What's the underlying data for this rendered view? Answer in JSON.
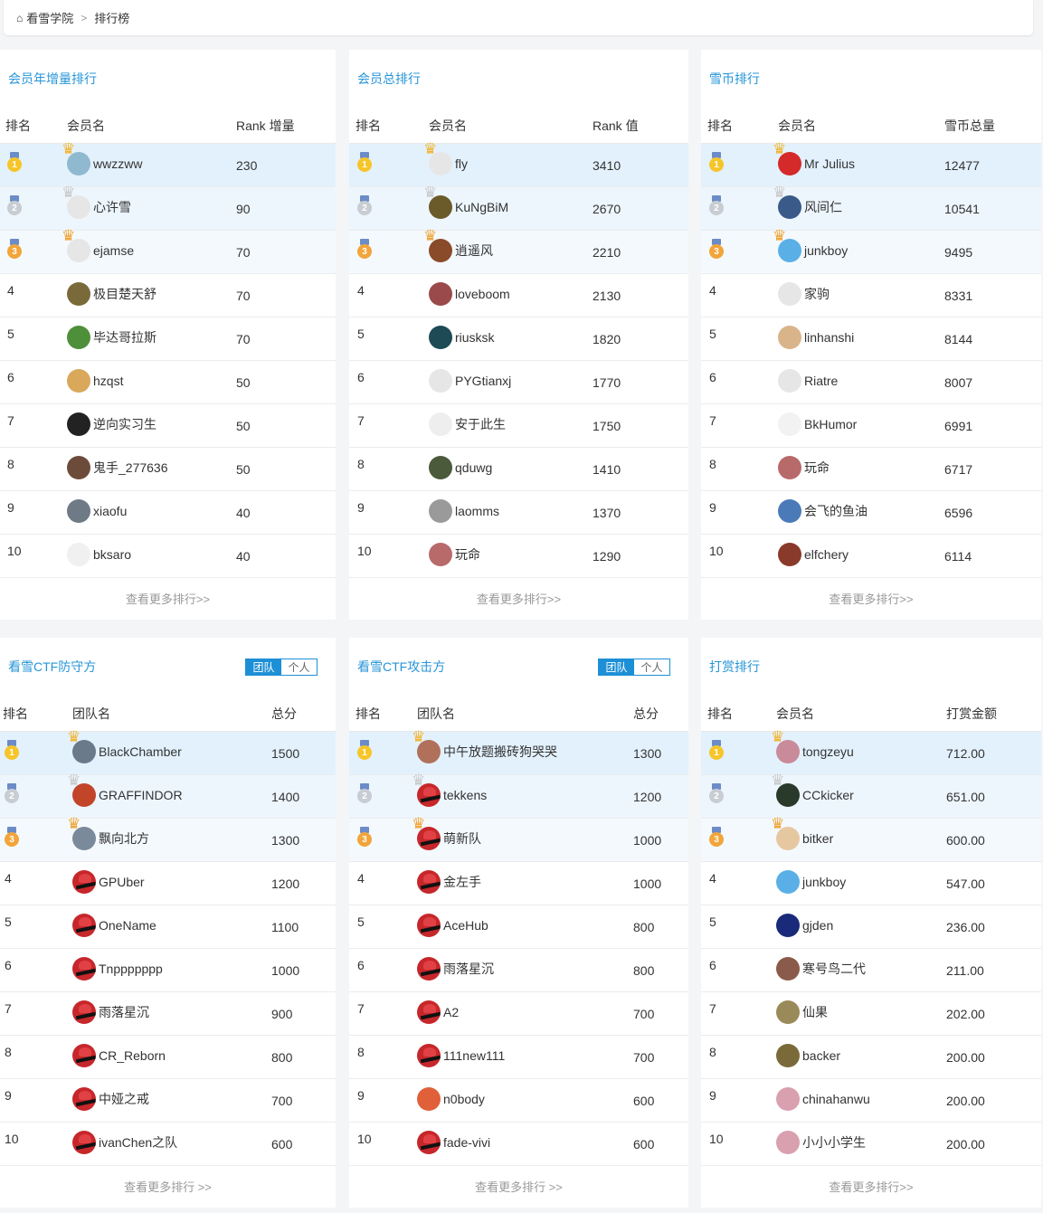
{
  "breadcrumb": {
    "home": "看雪学院",
    "current": "排行榜"
  },
  "more_label": "查看更多排行>>",
  "more_label_spaced": "查看更多排行 >>",
  "toggle": {
    "team": "团队",
    "personal": "个人"
  },
  "panels": [
    {
      "title": "会员年增量排行",
      "headers": [
        "排名",
        "会员名",
        "Rank 增量"
      ],
      "rows": [
        {
          "rank": "1",
          "name": "wwzzww",
          "value": "230",
          "avatar": "#8fb9cf"
        },
        {
          "rank": "2",
          "name": "心许雪",
          "value": "90",
          "avatar": "#e6e6e6"
        },
        {
          "rank": "3",
          "name": "ejamse",
          "value": "70",
          "avatar": "#e6e6e6"
        },
        {
          "rank": "4",
          "name": "极目楚天舒",
          "value": "70",
          "avatar": "#7a6a3a"
        },
        {
          "rank": "5",
          "name": "毕达哥拉斯",
          "value": "70",
          "avatar": "#4e8f3a"
        },
        {
          "rank": "6",
          "name": "hzqst",
          "value": "50",
          "avatar": "#d9a85a"
        },
        {
          "rank": "7",
          "name": "逆向实习生",
          "value": "50",
          "avatar": "#222222"
        },
        {
          "rank": "8",
          "name": "鬼手_277636",
          "value": "50",
          "avatar": "#6d4b3b"
        },
        {
          "rank": "9",
          "name": "xiaofu",
          "value": "40",
          "avatar": "#6e7a86"
        },
        {
          "rank": "10",
          "name": "bksaro",
          "value": "40",
          "avatar": "#f0f0f0"
        }
      ]
    },
    {
      "title": "会员总排行",
      "headers": [
        "排名",
        "会员名",
        "Rank 值"
      ],
      "rows": [
        {
          "rank": "1",
          "name": "fly",
          "value": "3410",
          "avatar": "#e6e6e6"
        },
        {
          "rank": "2",
          "name": "KuNgBiM",
          "value": "2670",
          "avatar": "#6b5a2a"
        },
        {
          "rank": "3",
          "name": "逍遥风",
          "value": "2210",
          "avatar": "#8a4b2a"
        },
        {
          "rank": "4",
          "name": "loveboom",
          "value": "2130",
          "avatar": "#9a4a4a"
        },
        {
          "rank": "5",
          "name": "riusksk",
          "value": "1820",
          "avatar": "#1d4a55"
        },
        {
          "rank": "6",
          "name": "PYGtianxj",
          "value": "1770",
          "avatar": "#e6e6e6"
        },
        {
          "rank": "7",
          "name": "安于此生",
          "value": "1750",
          "avatar": "#eeeeee"
        },
        {
          "rank": "8",
          "name": "qduwg",
          "value": "1410",
          "avatar": "#4a5a3a"
        },
        {
          "rank": "9",
          "name": "laomms",
          "value": "1370",
          "avatar": "#9a9a9a"
        },
        {
          "rank": "10",
          "name": "玩命",
          "value": "1290",
          "avatar": "#b86a6a"
        }
      ]
    },
    {
      "title": "雪币排行",
      "headers": [
        "排名",
        "会员名",
        "雪币总量"
      ],
      "rows": [
        {
          "rank": "1",
          "name": "Mr Julius",
          "value": "12477",
          "avatar": "#d42a2a"
        },
        {
          "rank": "2",
          "name": "风间仁",
          "value": "10541",
          "avatar": "#3a5a8a"
        },
        {
          "rank": "3",
          "name": "junkboy",
          "value": "9495",
          "avatar": "#5ab0e6"
        },
        {
          "rank": "4",
          "name": "家驹",
          "value": "8331",
          "avatar": "#e6e6e6"
        },
        {
          "rank": "5",
          "name": "linhanshi",
          "value": "8144",
          "avatar": "#d9b48a"
        },
        {
          "rank": "6",
          "name": "Riatre",
          "value": "8007",
          "avatar": "#e6e6e6"
        },
        {
          "rank": "7",
          "name": "BkHumor",
          "value": "6991",
          "avatar": "#f2f2f2"
        },
        {
          "rank": "8",
          "name": "玩命",
          "value": "6717",
          "avatar": "#b86a6a"
        },
        {
          "rank": "9",
          "name": "会飞的鱼油",
          "value": "6596",
          "avatar": "#4a7ab8"
        },
        {
          "rank": "10",
          "name": "elfchery",
          "value": "6114",
          "avatar": "#8a3a2a"
        }
      ]
    },
    {
      "title": "看雪CTF防守方",
      "toggle": true,
      "headers": [
        "排名",
        "团队名",
        "总分"
      ],
      "rows": [
        {
          "rank": "1",
          "name": "BlackChamber",
          "value": "1500",
          "avatar": "#6a7a8a"
        },
        {
          "rank": "2",
          "name": "GRAFFINDOR",
          "value": "1400",
          "avatar": "#c2452a"
        },
        {
          "rank": "3",
          "name": "飘向北方",
          "value": "1300",
          "avatar": "#7a8a9a"
        },
        {
          "rank": "4",
          "name": "GPUber",
          "value": "1200",
          "avatar": "hat"
        },
        {
          "rank": "5",
          "name": "OneName",
          "value": "1100",
          "avatar": "hat"
        },
        {
          "rank": "6",
          "name": "Tnppppppp",
          "value": "1000",
          "avatar": "hat"
        },
        {
          "rank": "7",
          "name": "雨落星沉",
          "value": "900",
          "avatar": "hat"
        },
        {
          "rank": "8",
          "name": "CR_Reborn",
          "value": "800",
          "avatar": "hat"
        },
        {
          "rank": "9",
          "name": "中娅之戒",
          "value": "700",
          "avatar": "hat"
        },
        {
          "rank": "10",
          "name": "ivanChen之队",
          "value": "600",
          "avatar": "hat"
        }
      ]
    },
    {
      "title": "看雪CTF攻击方",
      "toggle": true,
      "headers": [
        "排名",
        "团队名",
        "总分"
      ],
      "rows": [
        {
          "rank": "1",
          "name": "中午放题搬砖狗哭哭",
          "value": "1300",
          "avatar": "#b0705a"
        },
        {
          "rank": "2",
          "name": "tekkens",
          "value": "1200",
          "avatar": "hat"
        },
        {
          "rank": "3",
          "name": "萌新队",
          "value": "1000",
          "avatar": "hat"
        },
        {
          "rank": "4",
          "name": "金左手",
          "value": "1000",
          "avatar": "hat"
        },
        {
          "rank": "5",
          "name": "AceHub",
          "value": "800",
          "avatar": "hat"
        },
        {
          "rank": "6",
          "name": "雨落星沉",
          "value": "800",
          "avatar": "hat"
        },
        {
          "rank": "7",
          "name": "A2",
          "value": "700",
          "avatar": "hat"
        },
        {
          "rank": "8",
          "name": "111new111",
          "value": "700",
          "avatar": "hat"
        },
        {
          "rank": "9",
          "name": "n0body",
          "value": "600",
          "avatar": "#e0603a"
        },
        {
          "rank": "10",
          "name": "fade-vivi",
          "value": "600",
          "avatar": "hat"
        }
      ]
    },
    {
      "title": "打赏排行",
      "headers": [
        "排名",
        "会员名",
        "打赏金额"
      ],
      "rows": [
        {
          "rank": "1",
          "name": "tongzeyu",
          "value": "712.00",
          "avatar": "#c98a9a"
        },
        {
          "rank": "2",
          "name": "CCkicker",
          "value": "651.00",
          "avatar": "#2a3a2a"
        },
        {
          "rank": "3",
          "name": "bitker",
          "value": "600.00",
          "avatar": "#e6c8a0"
        },
        {
          "rank": "4",
          "name": "junkboy",
          "value": "547.00",
          "avatar": "#5ab0e6"
        },
        {
          "rank": "5",
          "name": "gjden",
          "value": "236.00",
          "avatar": "#1a2a7a"
        },
        {
          "rank": "6",
          "name": "寒号鸟二代",
          "value": "211.00",
          "avatar": "#8a5a4a"
        },
        {
          "rank": "7",
          "name": "仙果",
          "value": "202.00",
          "avatar": "#9a8a5a"
        },
        {
          "rank": "8",
          "name": "backer",
          "value": "200.00",
          "avatar": "#7a6a3a"
        },
        {
          "rank": "9",
          "name": "chinahanwu",
          "value": "200.00",
          "avatar": "#d9a0b0"
        },
        {
          "rank": "10",
          "name": "小小小学生",
          "value": "200.00",
          "avatar": "#d9a0b0"
        }
      ]
    }
  ]
}
